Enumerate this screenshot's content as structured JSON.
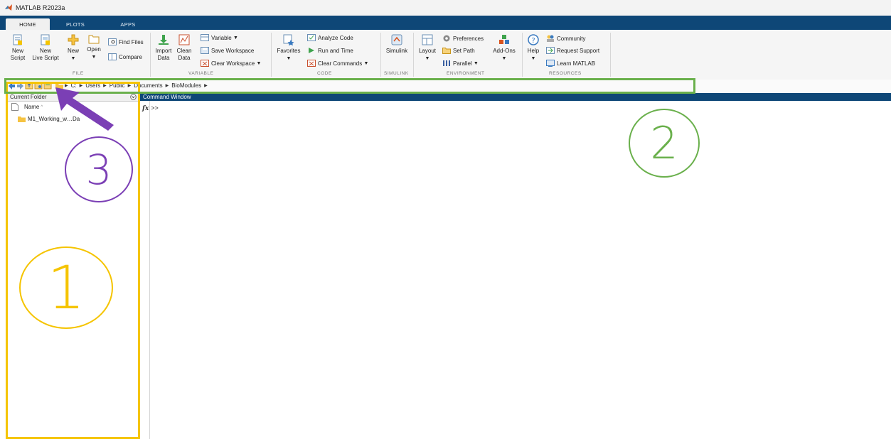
{
  "window": {
    "title": "MATLAB R2023a",
    "logo_icon": "matlab-logo-icon"
  },
  "tabs": [
    {
      "label": "HOME",
      "active": true
    },
    {
      "label": "PLOTS",
      "active": false
    },
    {
      "label": "APPS",
      "active": false
    }
  ],
  "ribbon": {
    "file": {
      "group_label": "FILE",
      "new_script": {
        "line1": "New",
        "line2": "Script"
      },
      "new_live_script": {
        "line1": "New",
        "line2": "Live Script"
      },
      "new": {
        "line1": "New"
      },
      "open": {
        "line1": "Open"
      },
      "find_files": "Find Files",
      "compare": "Compare"
    },
    "variable": {
      "group_label": "VARIABLE",
      "import_data": {
        "line1": "Import",
        "line2": "Data"
      },
      "clean_data": {
        "line1": "Clean",
        "line2": "Data"
      },
      "variable": "Variable",
      "save_workspace": "Save Workspace",
      "clear_workspace": "Clear Workspace"
    },
    "code": {
      "group_label": "CODE",
      "favorites": "Favorites",
      "analyze_code": "Analyze Code",
      "run_and_time": "Run and Time",
      "clear_commands": "Clear Commands"
    },
    "simulink": {
      "group_label": "SIMULINK",
      "simulink": "Simulink"
    },
    "environment": {
      "group_label": "ENVIRONMENT",
      "layout": "Layout",
      "preferences": "Preferences",
      "set_path": "Set Path",
      "parallel": "Parallel",
      "add_ons": "Add-Ons"
    },
    "resources": {
      "group_label": "RESOURCES",
      "help": "Help",
      "community": "Community",
      "request_support": "Request Support",
      "learn_matlab": "Learn MATLAB"
    }
  },
  "address": {
    "crumbs": [
      "C:",
      "Users",
      "Public",
      "Documents",
      "BioModules"
    ]
  },
  "current_folder": {
    "title": "Current Folder",
    "column_name": "Name",
    "sort_indicator": "^",
    "items": [
      {
        "name": "M1_Working_w…Da"
      }
    ]
  },
  "command_window": {
    "title": "Command Window",
    "fx": "fx",
    "prompt": ">>"
  },
  "annotations": [
    {
      "number": "1",
      "color": "#f5c400"
    },
    {
      "number": "2",
      "color": "#6ab04c"
    },
    {
      "number": "3",
      "color": "#7b3fb5"
    }
  ],
  "colors": {
    "tabbar": "#0e4777",
    "annotation_yellow": "#f5c400",
    "annotation_green": "#6ab04c",
    "annotation_purple": "#7b3fb5"
  }
}
